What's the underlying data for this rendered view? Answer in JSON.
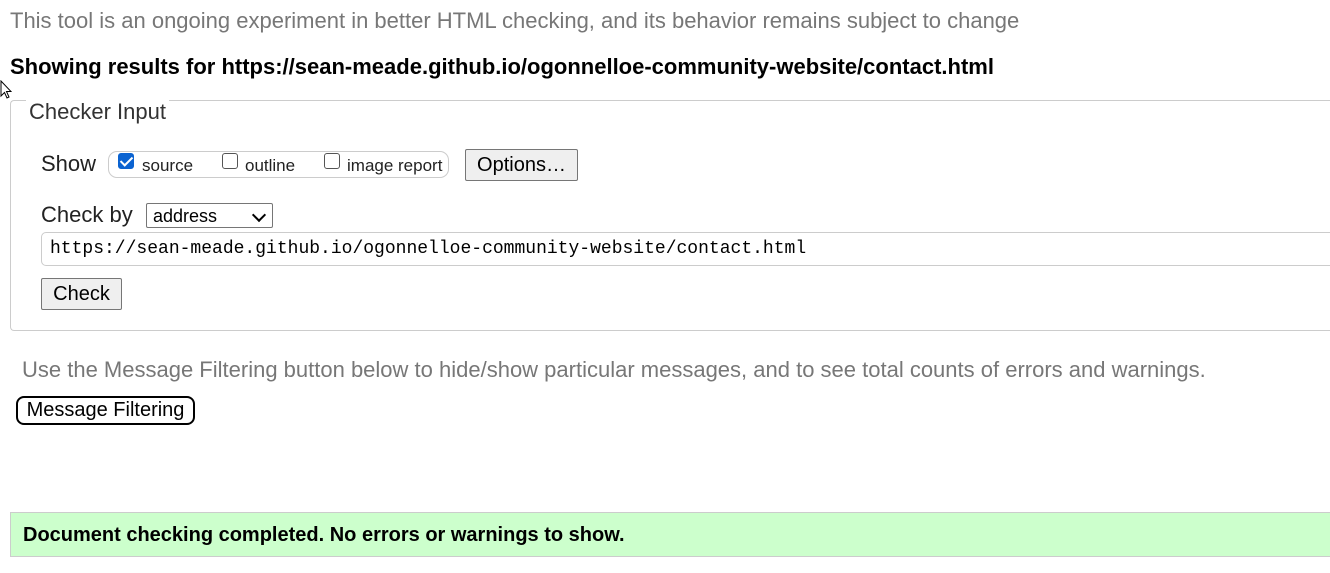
{
  "notice": "This tool is an ongoing experiment in better HTML checking, and its behavior remains subject to change",
  "results_heading": "Showing results for https://sean-meade.github.io/ogonnelloe-community-website/contact.html",
  "checker": {
    "legend": "Checker Input",
    "show_label": "Show",
    "show_options": [
      {
        "label": "source",
        "checked": true
      },
      {
        "label": "outline",
        "checked": false
      },
      {
        "label": "image report",
        "checked": false
      }
    ],
    "options_button": "Options…",
    "check_by_label": "Check by",
    "check_by_value": "address",
    "url_value": "https://sean-meade.github.io/ogonnelloe-community-website/contact.html",
    "check_button": "Check"
  },
  "filter": {
    "hint": "Use the Message Filtering button below to hide/show particular messages, and to see total counts of errors and warnings.",
    "button": "Message Filtering"
  },
  "status": {
    "message": "Document checking completed. No errors or warnings to show.",
    "color": "#ccffcc"
  }
}
